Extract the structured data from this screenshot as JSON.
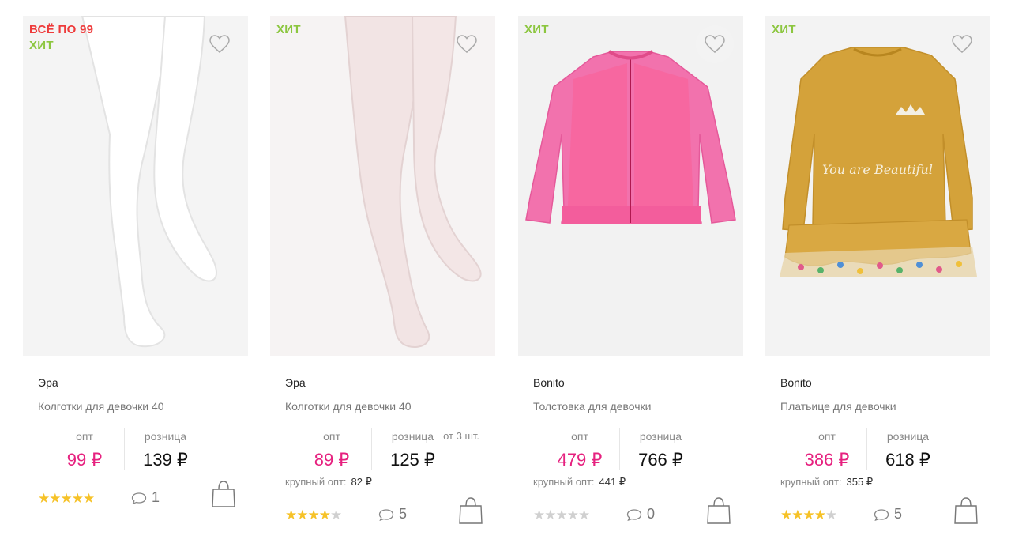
{
  "products": [
    {
      "badges": {
        "sale": "ВСЁ ПО 99",
        "hit": "ХИТ"
      },
      "brand": "Эра",
      "title": "Колготки для девочки 40",
      "price_labels": {
        "opt": "опт",
        "retail": "розница",
        "from": ""
      },
      "opt_price": "99 ₽",
      "retail_price": "139 ₽",
      "bulk_label": "",
      "bulk_value": "",
      "rating": 5,
      "stars": "★★★★★",
      "comments": "1",
      "image_icon": "white-tights-photo"
    },
    {
      "badges": {
        "sale": "",
        "hit": "ХИТ"
      },
      "brand": "Эра",
      "title": "Колготки для девочки 40",
      "price_labels": {
        "opt": "опт",
        "retail": "розница",
        "from": "от 3 шт."
      },
      "opt_price": "89 ₽",
      "retail_price": "125 ₽",
      "bulk_label": "крупный опт:",
      "bulk_value": "82 ₽",
      "rating": 4,
      "stars": "★★★★★",
      "comments": "5",
      "image_icon": "pink-tights-photo"
    },
    {
      "badges": {
        "sale": "",
        "hit": "ХИТ"
      },
      "brand": "Bonito",
      "title": "Толстовка для девочки",
      "price_labels": {
        "opt": "опт",
        "retail": "розница",
        "from": ""
      },
      "opt_price": "479 ₽",
      "retail_price": "766 ₽",
      "bulk_label": "крупный опт:",
      "bulk_value": "441 ₽",
      "rating": 0,
      "stars": "★★★★★",
      "comments": "0",
      "image_icon": "pink-lace-jacket-photo"
    },
    {
      "badges": {
        "sale": "",
        "hit": "ХИТ"
      },
      "brand": "Bonito",
      "title": "Платьице для девочки",
      "price_labels": {
        "opt": "опт",
        "retail": "розница",
        "from": ""
      },
      "opt_price": "386 ₽",
      "retail_price": "618 ₽",
      "bulk_label": "крупный опт:",
      "bulk_value": "355 ₽",
      "rating": 4,
      "stars": "★★★★★",
      "comments": "5",
      "image_icon": "mustard-dress-photo"
    }
  ],
  "colors": {
    "opt_price": "#e6217f",
    "badge_sale": "#ee3b3b",
    "badge_hit": "#8cc63f",
    "star_on": "#f6c228",
    "star_off": "#d0d0d0"
  },
  "dress_print": "You are Beautiful"
}
